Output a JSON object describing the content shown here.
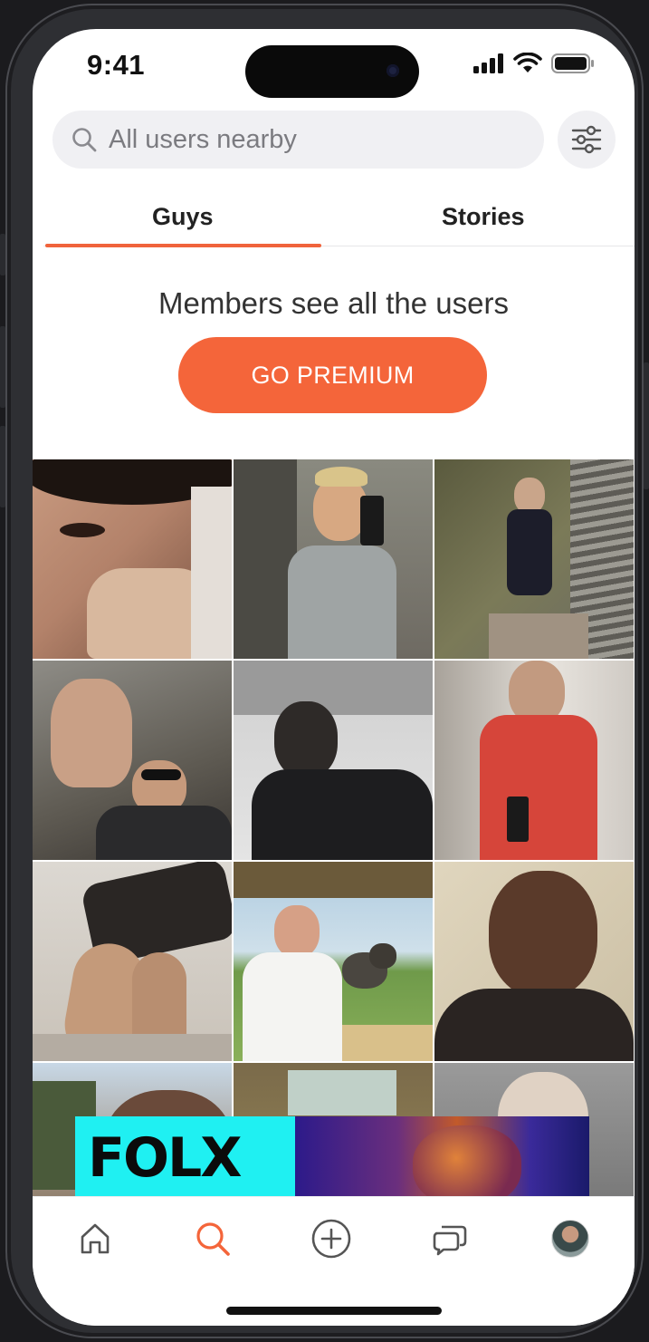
{
  "status_bar": {
    "time": "9:41"
  },
  "search": {
    "placeholder": "All users nearby",
    "icon": "search-icon"
  },
  "filter": {
    "icon": "sliders-icon"
  },
  "tabs": [
    {
      "label": "Guys",
      "active": true
    },
    {
      "label": "Stories",
      "active": false
    }
  ],
  "promo": {
    "message": "Members see all the users",
    "button_label": "GO PREMIUM"
  },
  "grid": {
    "columns": 3,
    "photos": [
      {
        "name": "user-photo-1"
      },
      {
        "name": "user-photo-2"
      },
      {
        "name": "user-photo-3"
      },
      {
        "name": "user-photo-4"
      },
      {
        "name": "user-photo-5"
      },
      {
        "name": "user-photo-6"
      },
      {
        "name": "user-photo-7"
      },
      {
        "name": "user-photo-8"
      },
      {
        "name": "user-photo-9"
      },
      {
        "name": "user-photo-10"
      },
      {
        "name": "user-photo-11"
      },
      {
        "name": "user-photo-12"
      }
    ]
  },
  "ad": {
    "brand": "FOLX"
  },
  "nav": [
    {
      "icon": "home-icon",
      "active": false
    },
    {
      "icon": "search-icon",
      "active": true
    },
    {
      "icon": "add-icon",
      "active": false
    },
    {
      "icon": "chat-icon",
      "active": false
    },
    {
      "icon": "profile-avatar",
      "active": false
    }
  ],
  "colors": {
    "accent": "#f4653a",
    "tab_underline": "#f0633c",
    "ad_cyan": "#1ff0f2"
  }
}
